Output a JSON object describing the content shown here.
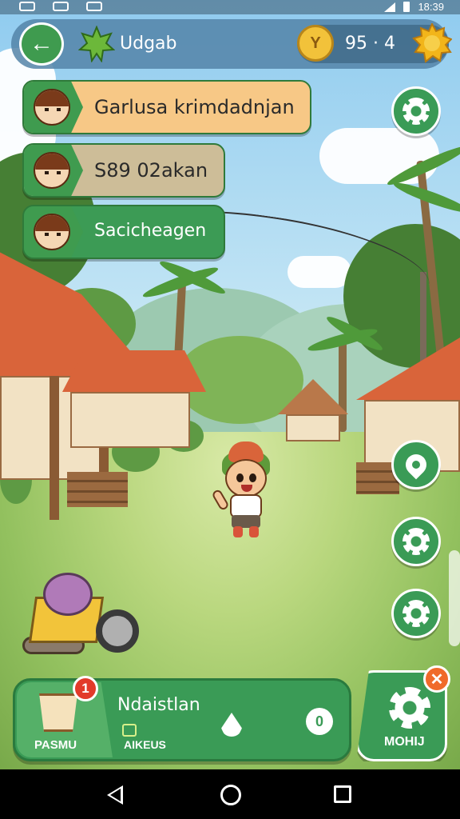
{
  "status_bar": {
    "time": "18:39"
  },
  "top_bar": {
    "player_name": "Udgab",
    "currency_text": "95 · 4"
  },
  "quests": [
    {
      "label": "Garlusa krimdadnjan"
    },
    {
      "label": "S89 02akan"
    },
    {
      "label": "Sacicheagen"
    }
  ],
  "bottom_bar": {
    "shop_label": "PASMU",
    "notification_count": "1",
    "panel_title": "Ndaistlan",
    "panel_subtitle": "AIKEUS",
    "more_label": "MOHIJ"
  },
  "icons": [
    "back-arrow-icon",
    "leaf-badge-icon",
    "coin-icon",
    "sun-icon",
    "gear-icon",
    "map-pin-icon",
    "bag-icon",
    "drop-icon",
    "shield-icon",
    "close-icon"
  ],
  "colors": {
    "accent_green": "#3a9b56",
    "quest_orange": "#f7c886",
    "notification_red": "#e23a2a"
  }
}
